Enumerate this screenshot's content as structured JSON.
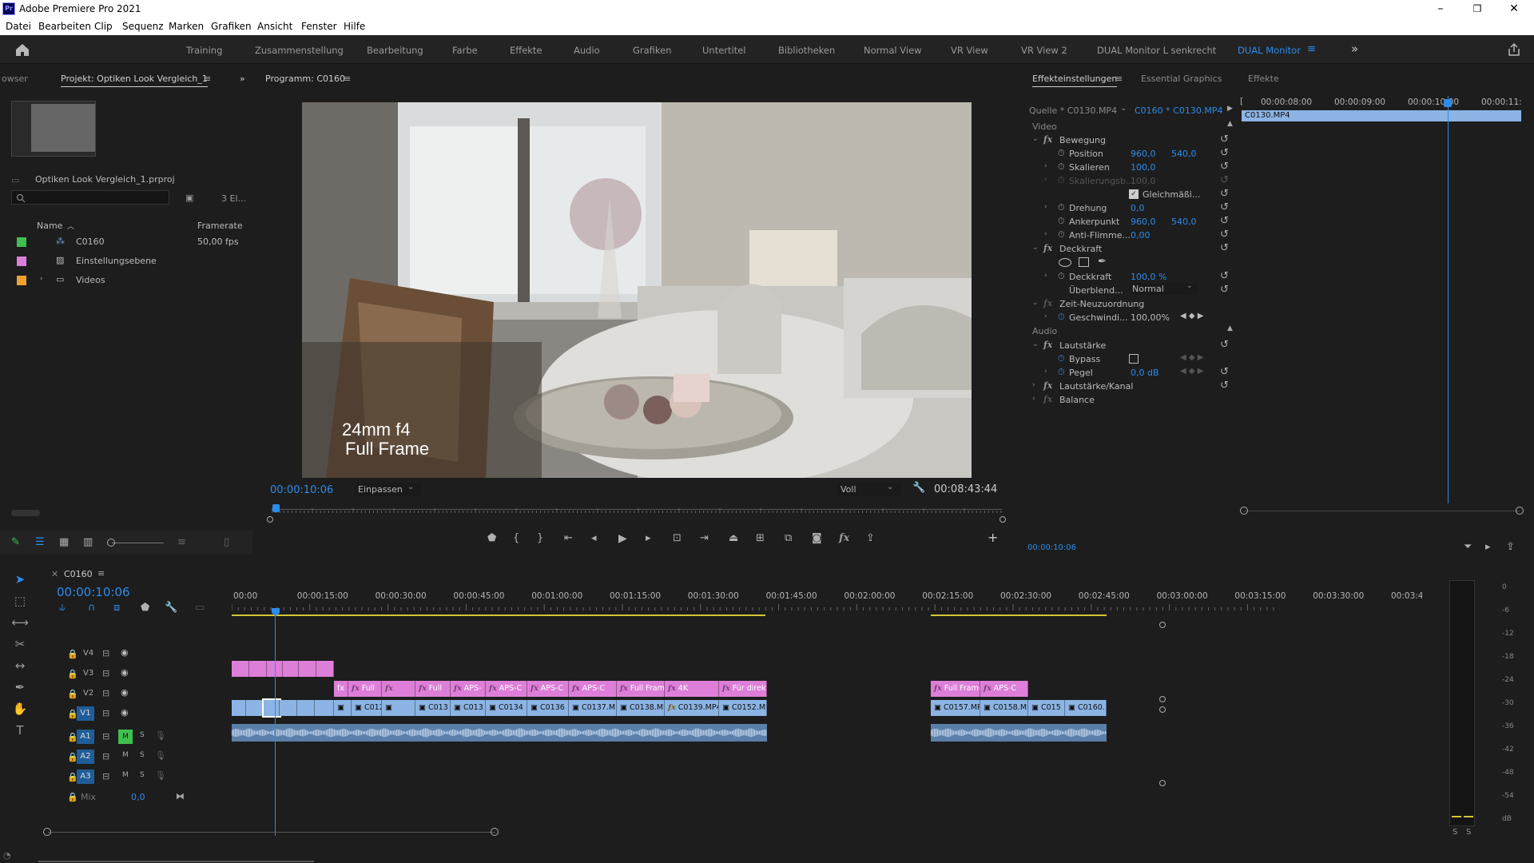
{
  "window": {
    "title": "Adobe Premiere Pro 2021",
    "app_icon": "Pr",
    "minimize": "–",
    "maximize": "❐",
    "close": "✕"
  },
  "menu": [
    "Datei",
    "Bearbeiten",
    "Clip",
    "Sequenz",
    "Marken",
    "Grafiken",
    "Ansicht",
    "Fenster",
    "Hilfe"
  ],
  "workspaces": [
    "Training",
    "Zusammenstellung",
    "Bearbeitung",
    "Farbe",
    "Effekte",
    "Audio",
    "Grafiken",
    "Untertitel",
    "Bibliotheken",
    "Normal View",
    "VR View",
    "VR View 2",
    "DUAL Monitor L senkrecht",
    "DUAL Monitor"
  ],
  "workspaces_more": "»",
  "project": {
    "tab_browser": "owser",
    "tab": "Projekt: Optiken Look Vergleich_1",
    "file": "Optiken Look Vergleich_1.prproj",
    "count": "3 El...",
    "col_name": "Name",
    "col_fps": "Framerate",
    "items": [
      {
        "name": "C0160",
        "fps": "50,00 fps",
        "color": "#3fbf4f"
      },
      {
        "name": "Einstellungsebene",
        "fps": "",
        "color": "#d97fdc"
      },
      {
        "name": "Videos",
        "fps": "",
        "color": "#f0a030"
      }
    ]
  },
  "program": {
    "tab": "Programm: C0160",
    "overlay_line1": "24mm f4",
    "overlay_line2": "Full Frame",
    "timecode": "00:00:10:06",
    "fit": "Einpassen",
    "quality": "Voll",
    "duration": "00:08:43:44"
  },
  "effects": {
    "tabs": [
      "Effekteinstellungen",
      "Essential Graphics",
      "Effekte"
    ],
    "source": "Quelle * C0130.MP4",
    "seq": "C0160 * C0130.MP4",
    "section_video": "Video",
    "section_audio": "Audio",
    "bewegung": "Bewegung",
    "position": {
      "label": "Position",
      "x": "960,0",
      "y": "540,0"
    },
    "skalieren": {
      "label": "Skalieren",
      "v": "100,0"
    },
    "skal_breite": {
      "label": "Skalierungsb...",
      "v": "100,0"
    },
    "gleichm": "Gleichmäßi...",
    "drehung": {
      "label": "Drehung",
      "v": "0,0"
    },
    "anker": {
      "label": "Ankerpunkt",
      "x": "960,0",
      "y": "540,0"
    },
    "antiflimmer": {
      "label": "Anti-Flimme...",
      "v": "0,00"
    },
    "deckkraft_h": "Deckkraft",
    "deckkraft": {
      "label": "Deckkraft",
      "v": "100,0 %"
    },
    "ueberblend": {
      "label": "Überblend...",
      "v": "Normal"
    },
    "zeit": "Zeit-Neuzuordnung",
    "geschw": {
      "label": "Geschwindi...",
      "v": "100,00%"
    },
    "lautstaerke": "Lautstärke",
    "bypass": "Bypass",
    "pegel": {
      "label": "Pegel",
      "v": "0,0 dB"
    },
    "lautkanal": "Lautstärke/Kanal",
    "balance": "Balance",
    "ruler": [
      "00:00:08:00",
      "00:00:09:00",
      "00:00:10:00",
      "00:00:11:"
    ],
    "clip": "C0130.MP4",
    "timecode": "00:00:10:06"
  },
  "timeline": {
    "tab": "C0160",
    "timecode": "00:00:10:06",
    "ruler": [
      "00:00",
      "00:00:15:00",
      "00:00:30:00",
      "00:00:45:00",
      "00:01:00:00",
      "00:01:15:00",
      "00:01:30:00",
      "00:01:45:00",
      "00:02:00:00",
      "00:02:15:00",
      "00:02:30:00",
      "00:02:45:00",
      "00:03:00:00",
      "00:03:15:00",
      "00:03:30:00",
      "00:03:45"
    ],
    "tracks_video": [
      "V4",
      "V3",
      "V2",
      "V1"
    ],
    "tracks_audio": [
      "A1",
      "A2",
      "A3"
    ],
    "mix": "Mix",
    "mix_val": "0,0",
    "m": "M",
    "s": "S",
    "v2_clips": [
      "Full",
      "Full",
      "APS-",
      "APS-C",
      "APS-C",
      "APS-C",
      "Full Fram",
      "4K",
      "Für direkt",
      "Full Frame",
      "APS-C"
    ],
    "v1_clips": [
      "C012",
      "C013",
      "C013",
      "C0134",
      "C0136",
      "C0137.M",
      "C0138.MP",
      "C0139.MP4 [",
      "C0152.MP",
      "C0157.MP4",
      "C0158.M",
      "C015",
      "C0160."
    ],
    "meter_scale": [
      "0",
      "-6",
      "-12",
      "-18",
      "-24",
      "-30",
      "-36",
      "-42",
      "-48",
      "-54",
      "dB"
    ],
    "meter_solo": [
      "S",
      "S"
    ]
  }
}
